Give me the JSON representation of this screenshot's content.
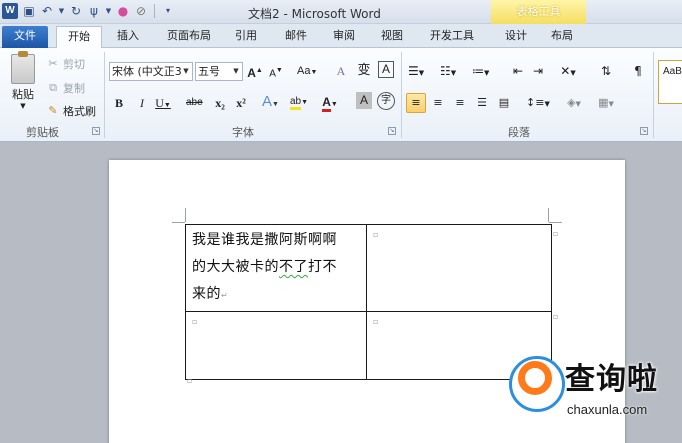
{
  "window": {
    "title": "文档2 - Microsoft Word",
    "contextual_tab_group": "表格工具"
  },
  "qat": {
    "app_icon": "W",
    "icons": [
      "save-icon",
      "undo-icon",
      "redo-icon",
      "repeat-icon",
      "color-icon",
      "clear-icon",
      "customize-icon"
    ]
  },
  "tabs": [
    {
      "label": "文件"
    },
    {
      "label": "开始"
    },
    {
      "label": "插入"
    },
    {
      "label": "页面布局"
    },
    {
      "label": "引用"
    },
    {
      "label": "邮件"
    },
    {
      "label": "审阅"
    },
    {
      "label": "视图"
    },
    {
      "label": "开发工具"
    },
    {
      "label": "设计"
    },
    {
      "label": "布局"
    }
  ],
  "clipboard": {
    "paste_label": "粘贴",
    "cut_label": "剪切",
    "copy_label": "复制",
    "format_painter_label": "格式刷",
    "group_label": "剪贴板"
  },
  "font": {
    "font_name": "宋体 (中文正3",
    "font_size": "五号",
    "grow_label": "A",
    "shrink_label": "A",
    "case_label": "Aa",
    "clear_label": "A",
    "bold_label": "B",
    "italic_label": "I",
    "underline_label": "U",
    "strike_label": "abe",
    "sub_label": "x₂",
    "sup_label": "x²",
    "effects_label": "A",
    "highlight_label": "ab",
    "fontcolor_label": "A",
    "shading_label": "A",
    "enclose_label": "字",
    "pinyin_label": "wén",
    "phonetic_label": "变",
    "border_char_label": "A",
    "group_label": "字体",
    "highlight_color": "#f2e41a",
    "font_color": "#d42020"
  },
  "paragraph": {
    "group_label": "段落",
    "accent_color": "#f9cf6a"
  },
  "styles": {
    "preview": "AaB"
  },
  "document": {
    "cell1_lines": [
      "我是谁我是撒阿斯啊啊",
      "的大大被卡的",
      "打不",
      "来的"
    ],
    "cell1_squiggle": "不了"
  },
  "watermark": {
    "title": "查询啦",
    "domain": "chaxunla.com"
  }
}
